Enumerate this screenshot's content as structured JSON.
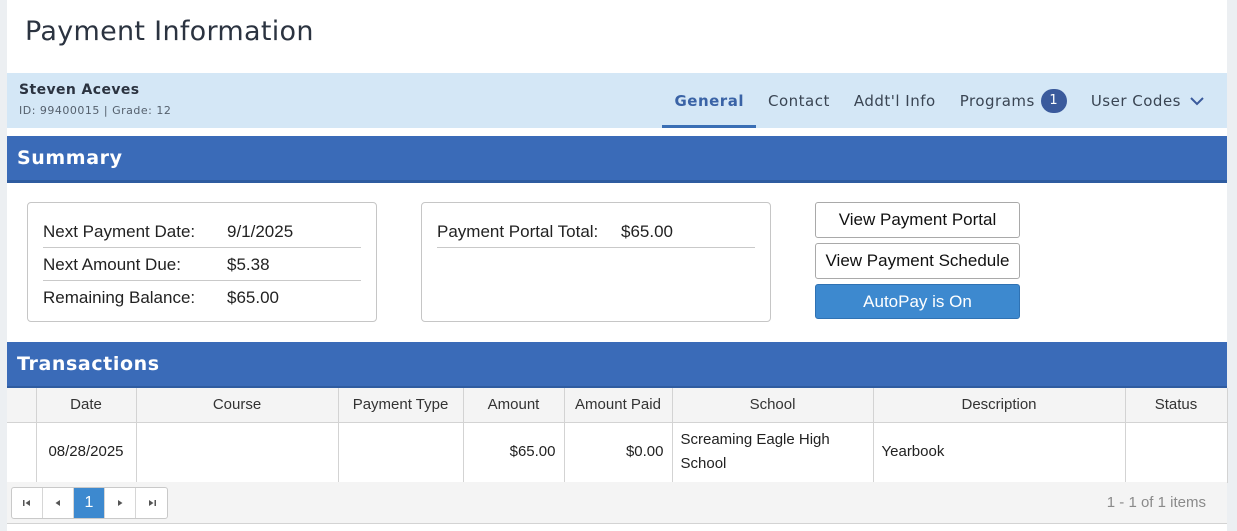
{
  "page": {
    "title": "Payment Information"
  },
  "student": {
    "name": "Steven Aceves",
    "meta": "ID: 99400015 |  Grade: 12"
  },
  "tabs": [
    {
      "label": "General",
      "active": true
    },
    {
      "label": "Contact"
    },
    {
      "label": "Addt'l Info"
    },
    {
      "label": "Programs",
      "badge": "1"
    },
    {
      "label": "User Codes",
      "icon": "chevron-down-icon"
    }
  ],
  "summary": {
    "title": "Summary",
    "left_card": [
      {
        "label": "Next Payment Date:",
        "value": "9/1/2025"
      },
      {
        "label": "Next Amount Due:",
        "value": "$5.38"
      },
      {
        "label": "Remaining Balance:",
        "value": "$65.00"
      }
    ],
    "right_card": [
      {
        "label": "Payment Portal Total:",
        "value": "$65.00"
      }
    ],
    "buttons": {
      "view_portal": "View Payment Portal",
      "view_schedule": "View Payment Schedule",
      "autopay": "AutoPay is On"
    }
  },
  "transactions": {
    "title": "Transactions",
    "columns": [
      "",
      "Date",
      "Course",
      "Payment Type",
      "Amount",
      "Amount Paid",
      "School",
      "Description",
      "Status"
    ],
    "rows": [
      {
        "date": "08/28/2025",
        "course": "",
        "payment_type": "",
        "amount": "$65.00",
        "amount_paid": "$0.00",
        "school": "Screaming Eagle High School",
        "description": "Yearbook",
        "status": ""
      }
    ],
    "pager": {
      "current_page": "1",
      "info": "1 - 1 of 1 items"
    }
  },
  "colors": {
    "section_header": "#3a6bb8",
    "student_bar": "#d4e7f6",
    "primary_button": "#3d89cf",
    "badge": "#3a5a9c"
  }
}
